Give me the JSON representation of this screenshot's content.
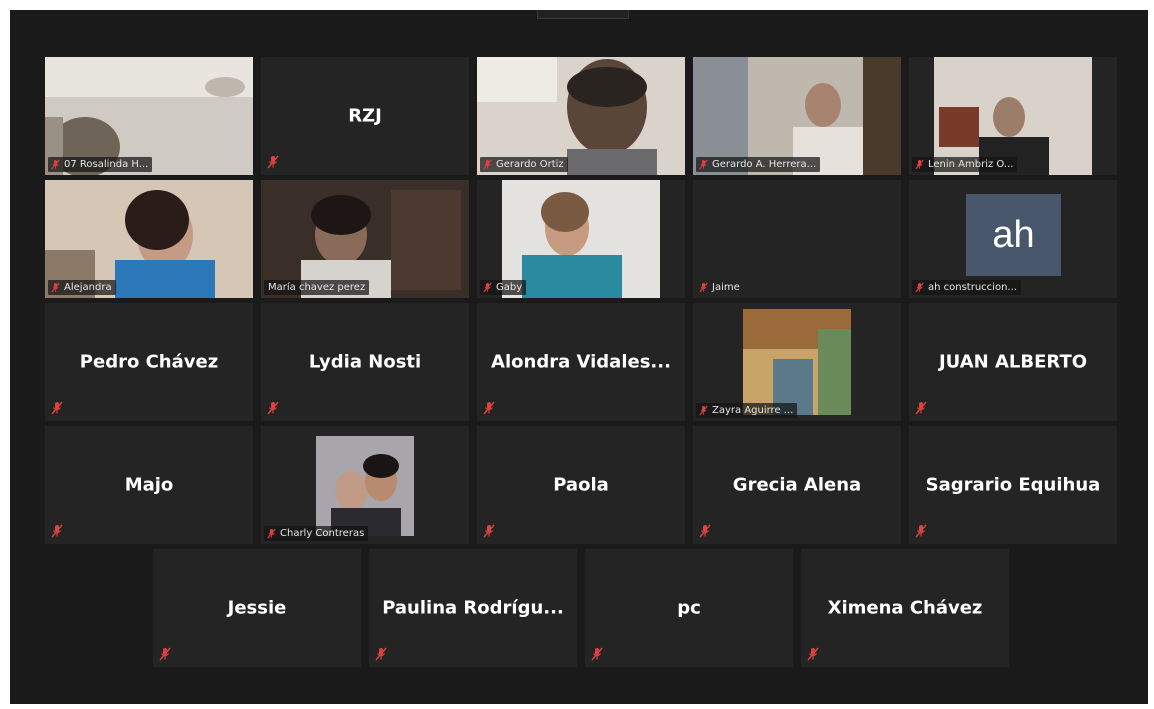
{
  "app": {
    "name": "Video meeting gallery view"
  },
  "colors": {
    "background": "#1a1a1a",
    "tile": "#242424",
    "active_speaker": "#c8d64a",
    "muted_mic": "#e04040"
  },
  "participants": {
    "rosalinda": "07 Rosalinda H...",
    "rzj": "RZJ",
    "gerardo_ortiz": "Gerardo Ortiz",
    "gerardo_herrera": "Gerardo A. Herrera...",
    "lenin": "Lenin Ambriz O...",
    "alejandra": "Alejandra",
    "maria": "María chavez perez",
    "gaby": "Gaby",
    "jaime": "Jaime",
    "ah_initials": "ah",
    "ah": "ah construccion...",
    "pedro": "Pedro Chávez",
    "lydia": "Lydia Nosti",
    "alondra": "Alondra  Vidales...",
    "zayra": "Zayra  Aguirre ...",
    "juan": "JUAN ALBERTO",
    "majo": "Majo",
    "charly": "Charly Contreras",
    "paola": "Paola",
    "grecia": "Grecia Alena",
    "sagrario": "Sagrario Equihua",
    "jessie": "Jessie",
    "paulina": "Paulina  Rodrígu...",
    "pc": "pc",
    "ximena": "Ximena Chávez"
  },
  "icons": {
    "muted": "mic-muted-icon"
  }
}
